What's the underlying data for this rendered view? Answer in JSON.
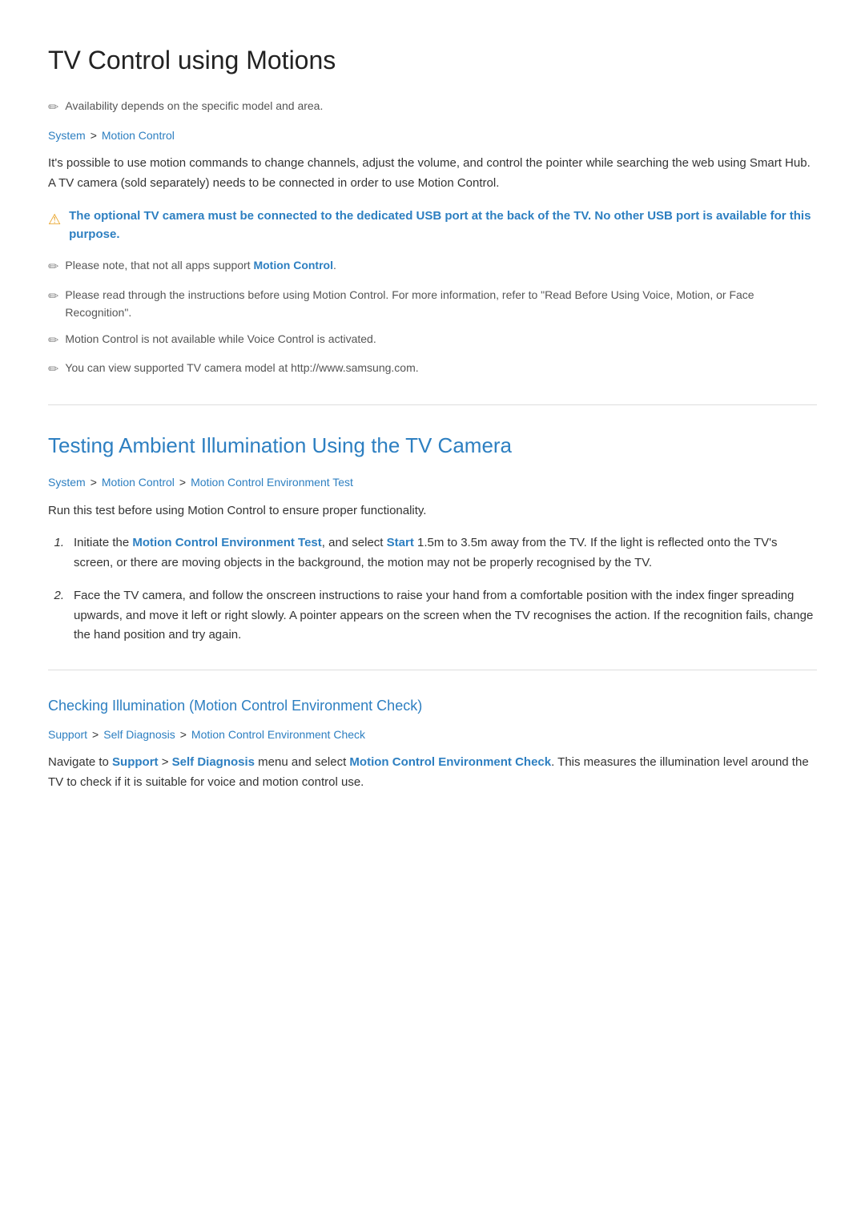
{
  "page": {
    "title": "TV Control using Motions",
    "availability_note": "Availability depends on the specific model and area.",
    "section1": {
      "breadcrumb": [
        "System",
        "Motion Control"
      ],
      "body": "It's possible to use motion commands to change channels, adjust the volume, and control the pointer while searching the web using Smart Hub. A TV camera (sold separately) needs to be connected in order to use Motion Control.",
      "warning": "The optional TV camera must be connected to the dedicated USB port at the back of the TV. No other USB port is available for this purpose.",
      "notes": [
        "Please note, that not all apps support Motion Control.",
        "Please read through the instructions before using Motion Control. For more information, refer to \"Read Before Using Voice, Motion, or Face Recognition\".",
        "Motion Control is not available while Voice Control is activated.",
        "You can view supported TV camera model at http://www.samsung.com."
      ],
      "note1_link": "Motion Control",
      "note1_before": "Please note, that not all apps support ",
      "note1_after": ".",
      "note2_text": "Please read through the instructions before using Motion Control. For more information, refer to \"Read Before Using Voice, Motion, or Face Recognition\".",
      "note3_text": "Motion Control is not available while Voice Control is activated.",
      "note4_text": "You can view supported TV camera model at http://www.samsung.com."
    },
    "section2": {
      "heading": "Testing Ambient Illumination Using the TV Camera",
      "breadcrumb": [
        "System",
        "Motion Control",
        "Motion Control Environment Test"
      ],
      "intro": "Run this test before using Motion Control to ensure proper functionality.",
      "steps": [
        {
          "number": "1.",
          "before": "Initiate the ",
          "link1": "Motion Control Environment Test",
          "middle": ", and select ",
          "link2": "Start",
          "after": " 1.5m to 3.5m away from the TV. If the light is reflected onto the TV's screen, or there are moving objects in the background, the motion may not be properly recognised by the TV."
        },
        {
          "number": "2.",
          "text": "Face the TV camera, and follow the onscreen instructions to raise your hand from a comfortable position with the index finger spreading upwards, and move it left or right slowly. A pointer appears on the screen when the TV recognises the action. If the recognition fails, change the hand position and try again."
        }
      ]
    },
    "section3": {
      "heading": "Checking Illumination (Motion Control Environment Check)",
      "breadcrumb": [
        "Support",
        "Self Diagnosis",
        "Motion Control Environment Check"
      ],
      "body_before": "Navigate to ",
      "link1": "Support",
      "separator": " › ",
      "link2": "Self Diagnosis",
      "body_middle": " menu and select ",
      "link3": "Motion Control Environment Check",
      "body_after": ". This measures the illumination level around the TV to check if it is suitable for voice and motion control use."
    }
  }
}
